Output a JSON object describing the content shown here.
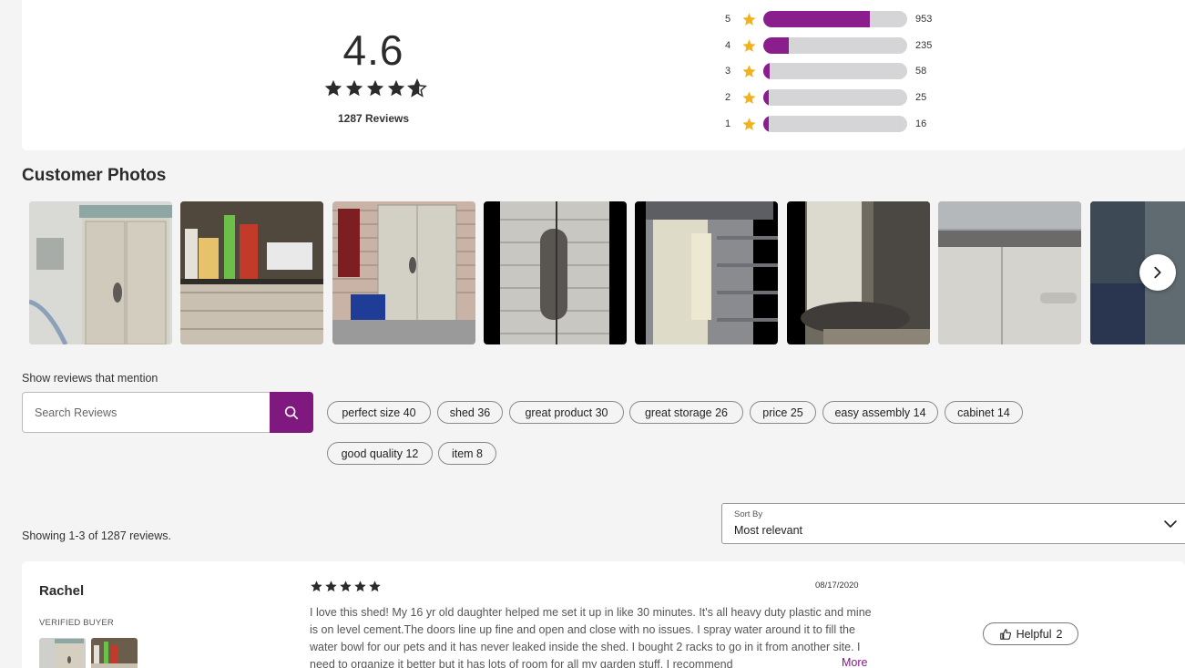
{
  "summary": {
    "average": "4.6",
    "average_rating": 4.6,
    "review_count_label": "1287 Reviews",
    "distribution": [
      {
        "stars": "5",
        "count": "953",
        "fraction": 0.74
      },
      {
        "stars": "4",
        "count": "235",
        "fraction": 0.18
      },
      {
        "stars": "3",
        "count": "58",
        "fraction": 0.045
      },
      {
        "stars": "2",
        "count": "25",
        "fraction": 0.019
      },
      {
        "stars": "1",
        "count": "16",
        "fraction": 0.012
      }
    ],
    "bar_color": "#8a1e8c",
    "star_color": "#f2b21b"
  },
  "photos": {
    "title": "Customer Photos",
    "next_icon": "chevron-right-icon"
  },
  "mentions": {
    "label": "Show reviews that mention",
    "search_placeholder": "Search Reviews",
    "search_icon": "search-icon",
    "chips": [
      "perfect size 40",
      "shed 36",
      "great product 30",
      "great storage 26",
      "price 25",
      "easy assembly 14",
      "cabinet 14",
      "good quality 12",
      "item 8"
    ]
  },
  "listing": {
    "showing": "Showing 1-3 of 1287 reviews.",
    "sort_label": "Sort By",
    "sort_value": "Most relevant"
  },
  "review": {
    "name": "Rachel",
    "badge": "VERIFIED BUYER",
    "rating": 5,
    "date": "08/17/2020",
    "text": "I love this shed! My 16 yr old daughter helped me set it up in like 30 minutes. It's all heavy duty plastic and mine is on level cement.The doors line up fine and open and close with no issues. I spray water around it to fill the water bowl for our pets and it has never leaked inside the shed. I bought 2 racks to go in it from another site. I need to organize it better but it has lots of room for all my garden stuff. I recommend",
    "more_label": "More",
    "helpful_label": "Helpful",
    "helpful_count": "2"
  },
  "accent_color": "#7f187f"
}
